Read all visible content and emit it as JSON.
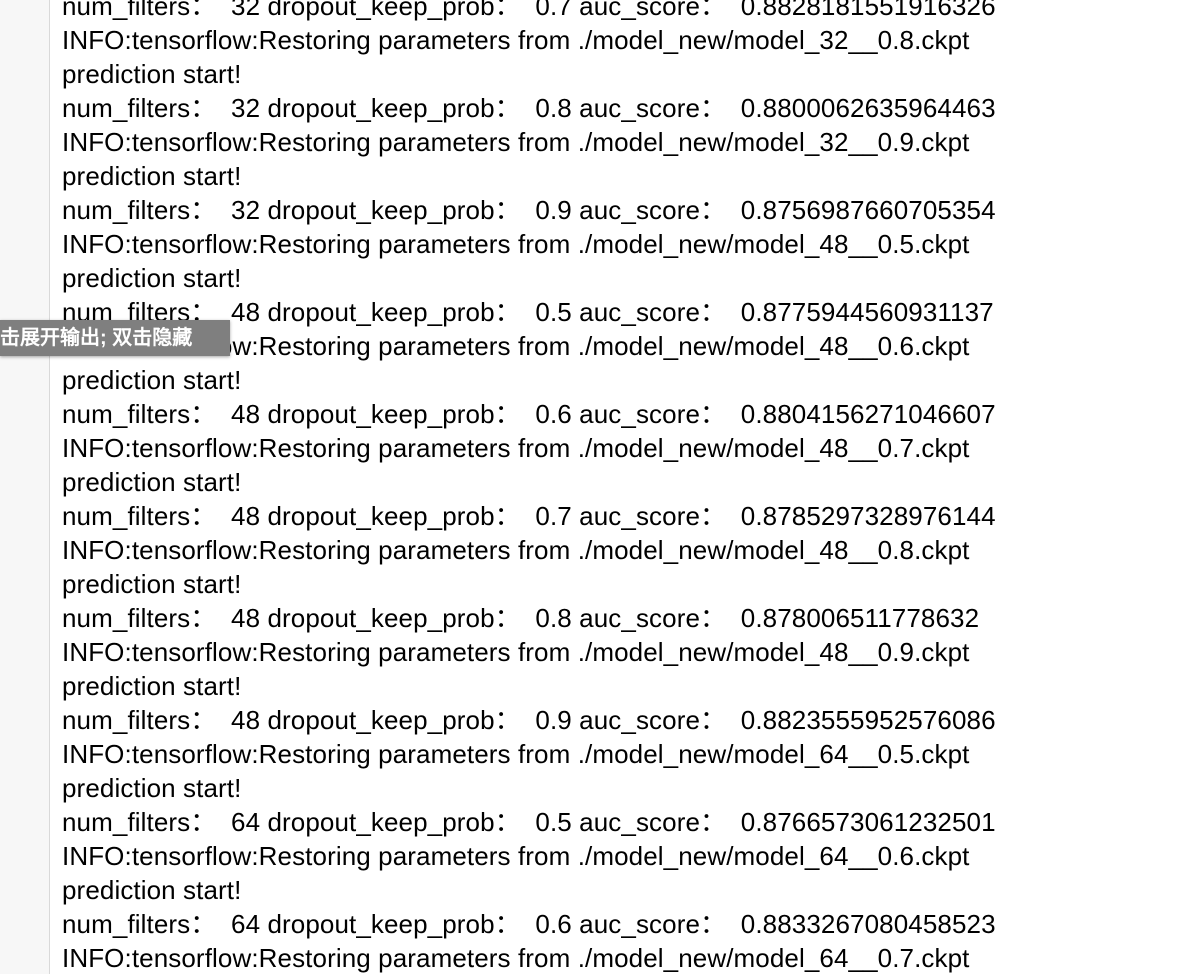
{
  "output_lines": [
    "num_filters：  32 dropout_keep_prob：  0.7 auc_score：  0.8828181551916326",
    "INFO:tensorflow:Restoring parameters from ./model_new/model_32__0.8.ckpt",
    "prediction start!",
    "num_filters：  32 dropout_keep_prob：  0.8 auc_score：  0.8800062635964463",
    "INFO:tensorflow:Restoring parameters from ./model_new/model_32__0.9.ckpt",
    "prediction start!",
    "num_filters：  32 dropout_keep_prob：  0.9 auc_score：  0.8756987660705354",
    "INFO:tensorflow:Restoring parameters from ./model_new/model_48__0.5.ckpt",
    "prediction start!",
    "num_filters：  48 dropout_keep_prob：  0.5 auc_score：  0.8775944560931137",
    "INFO:tensorflow:Restoring parameters from ./model_new/model_48__0.6.ckpt",
    "prediction start!",
    "num_filters：  48 dropout_keep_prob：  0.6 auc_score：  0.8804156271046607",
    "INFO:tensorflow:Restoring parameters from ./model_new/model_48__0.7.ckpt",
    "prediction start!",
    "num_filters：  48 dropout_keep_prob：  0.7 auc_score：  0.8785297328976144",
    "INFO:tensorflow:Restoring parameters from ./model_new/model_48__0.8.ckpt",
    "prediction start!",
    "num_filters：  48 dropout_keep_prob：  0.8 auc_score：  0.878006511778632",
    "INFO:tensorflow:Restoring parameters from ./model_new/model_48__0.9.ckpt",
    "prediction start!",
    "num_filters：  48 dropout_keep_prob：  0.9 auc_score：  0.8823555952576086",
    "INFO:tensorflow:Restoring parameters from ./model_new/model_64__0.5.ckpt",
    "prediction start!",
    "num_filters：  64 dropout_keep_prob：  0.5 auc_score：  0.8766573061232501",
    "INFO:tensorflow:Restoring parameters from ./model_new/model_64__0.6.ckpt",
    "prediction start!",
    "num_filters：  64 dropout_keep_prob：  0.6 auc_score：  0.8833267080458523",
    "INFO:tensorflow:Restoring parameters from ./model_new/model_64__0.7.ckpt"
  ],
  "tooltip": {
    "text": "击展开输出; 双击隐藏"
  }
}
